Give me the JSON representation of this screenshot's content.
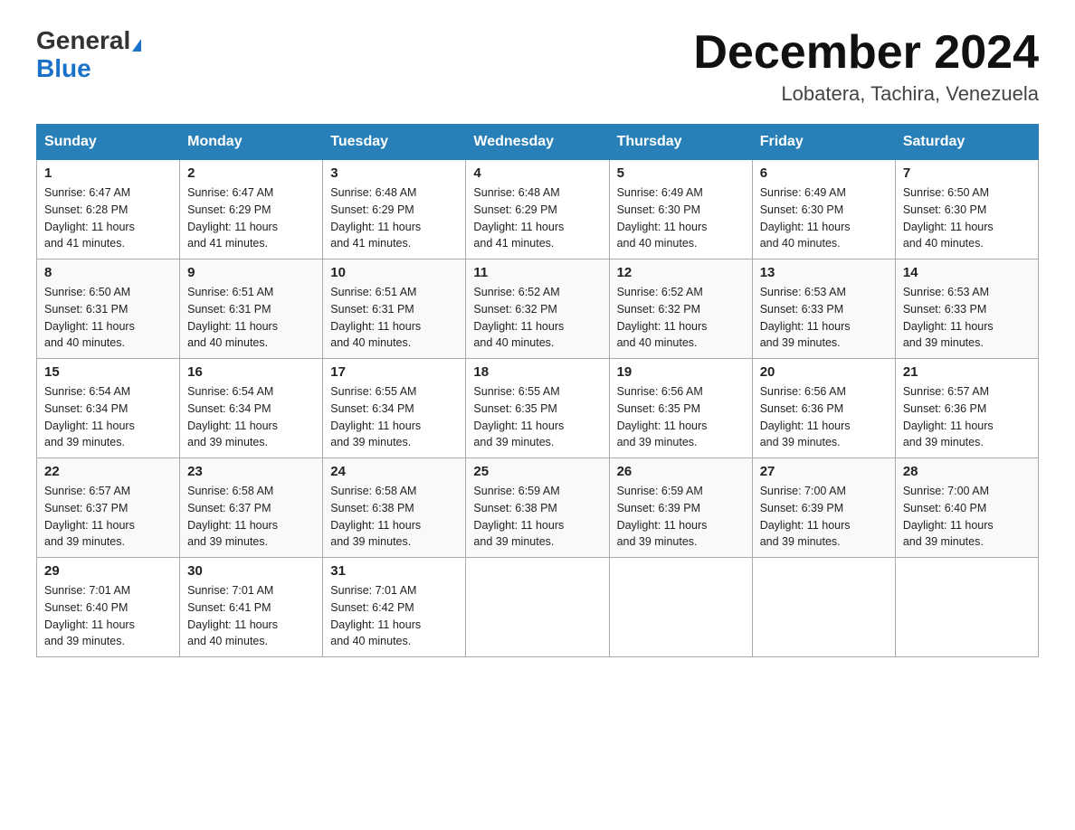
{
  "header": {
    "logo_general": "General",
    "logo_blue": "Blue",
    "month_title": "December 2024",
    "location": "Lobatera, Tachira, Venezuela"
  },
  "days_of_week": [
    "Sunday",
    "Monday",
    "Tuesday",
    "Wednesday",
    "Thursday",
    "Friday",
    "Saturday"
  ],
  "weeks": [
    [
      {
        "day": "1",
        "sunrise": "6:47 AM",
        "sunset": "6:28 PM",
        "daylight": "11 hours and 41 minutes."
      },
      {
        "day": "2",
        "sunrise": "6:47 AM",
        "sunset": "6:29 PM",
        "daylight": "11 hours and 41 minutes."
      },
      {
        "day": "3",
        "sunrise": "6:48 AM",
        "sunset": "6:29 PM",
        "daylight": "11 hours and 41 minutes."
      },
      {
        "day": "4",
        "sunrise": "6:48 AM",
        "sunset": "6:29 PM",
        "daylight": "11 hours and 41 minutes."
      },
      {
        "day": "5",
        "sunrise": "6:49 AM",
        "sunset": "6:30 PM",
        "daylight": "11 hours and 40 minutes."
      },
      {
        "day": "6",
        "sunrise": "6:49 AM",
        "sunset": "6:30 PM",
        "daylight": "11 hours and 40 minutes."
      },
      {
        "day": "7",
        "sunrise": "6:50 AM",
        "sunset": "6:30 PM",
        "daylight": "11 hours and 40 minutes."
      }
    ],
    [
      {
        "day": "8",
        "sunrise": "6:50 AM",
        "sunset": "6:31 PM",
        "daylight": "11 hours and 40 minutes."
      },
      {
        "day": "9",
        "sunrise": "6:51 AM",
        "sunset": "6:31 PM",
        "daylight": "11 hours and 40 minutes."
      },
      {
        "day": "10",
        "sunrise": "6:51 AM",
        "sunset": "6:31 PM",
        "daylight": "11 hours and 40 minutes."
      },
      {
        "day": "11",
        "sunrise": "6:52 AM",
        "sunset": "6:32 PM",
        "daylight": "11 hours and 40 minutes."
      },
      {
        "day": "12",
        "sunrise": "6:52 AM",
        "sunset": "6:32 PM",
        "daylight": "11 hours and 40 minutes."
      },
      {
        "day": "13",
        "sunrise": "6:53 AM",
        "sunset": "6:33 PM",
        "daylight": "11 hours and 39 minutes."
      },
      {
        "day": "14",
        "sunrise": "6:53 AM",
        "sunset": "6:33 PM",
        "daylight": "11 hours and 39 minutes."
      }
    ],
    [
      {
        "day": "15",
        "sunrise": "6:54 AM",
        "sunset": "6:34 PM",
        "daylight": "11 hours and 39 minutes."
      },
      {
        "day": "16",
        "sunrise": "6:54 AM",
        "sunset": "6:34 PM",
        "daylight": "11 hours and 39 minutes."
      },
      {
        "day": "17",
        "sunrise": "6:55 AM",
        "sunset": "6:34 PM",
        "daylight": "11 hours and 39 minutes."
      },
      {
        "day": "18",
        "sunrise": "6:55 AM",
        "sunset": "6:35 PM",
        "daylight": "11 hours and 39 minutes."
      },
      {
        "day": "19",
        "sunrise": "6:56 AM",
        "sunset": "6:35 PM",
        "daylight": "11 hours and 39 minutes."
      },
      {
        "day": "20",
        "sunrise": "6:56 AM",
        "sunset": "6:36 PM",
        "daylight": "11 hours and 39 minutes."
      },
      {
        "day": "21",
        "sunrise": "6:57 AM",
        "sunset": "6:36 PM",
        "daylight": "11 hours and 39 minutes."
      }
    ],
    [
      {
        "day": "22",
        "sunrise": "6:57 AM",
        "sunset": "6:37 PM",
        "daylight": "11 hours and 39 minutes."
      },
      {
        "day": "23",
        "sunrise": "6:58 AM",
        "sunset": "6:37 PM",
        "daylight": "11 hours and 39 minutes."
      },
      {
        "day": "24",
        "sunrise": "6:58 AM",
        "sunset": "6:38 PM",
        "daylight": "11 hours and 39 minutes."
      },
      {
        "day": "25",
        "sunrise": "6:59 AM",
        "sunset": "6:38 PM",
        "daylight": "11 hours and 39 minutes."
      },
      {
        "day": "26",
        "sunrise": "6:59 AM",
        "sunset": "6:39 PM",
        "daylight": "11 hours and 39 minutes."
      },
      {
        "day": "27",
        "sunrise": "7:00 AM",
        "sunset": "6:39 PM",
        "daylight": "11 hours and 39 minutes."
      },
      {
        "day": "28",
        "sunrise": "7:00 AM",
        "sunset": "6:40 PM",
        "daylight": "11 hours and 39 minutes."
      }
    ],
    [
      {
        "day": "29",
        "sunrise": "7:01 AM",
        "sunset": "6:40 PM",
        "daylight": "11 hours and 39 minutes."
      },
      {
        "day": "30",
        "sunrise": "7:01 AM",
        "sunset": "6:41 PM",
        "daylight": "11 hours and 40 minutes."
      },
      {
        "day": "31",
        "sunrise": "7:01 AM",
        "sunset": "6:42 PM",
        "daylight": "11 hours and 40 minutes."
      },
      null,
      null,
      null,
      null
    ]
  ],
  "labels": {
    "sunrise": "Sunrise:",
    "sunset": "Sunset:",
    "daylight": "Daylight:"
  }
}
